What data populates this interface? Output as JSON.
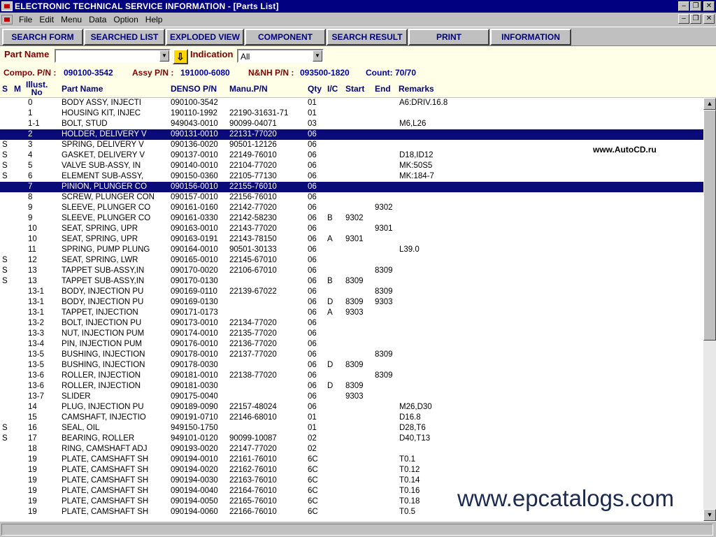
{
  "window": {
    "title": "ELECTRONIC TECHNICAL SERVICE INFORMATION - [Parts List]"
  },
  "menu": [
    "File",
    "Edit",
    "Menu",
    "Data",
    "Option",
    "Help"
  ],
  "toolbar": [
    "SEARCH FORM",
    "SEARCHED LIST",
    "EXPLODED VIEW",
    "COMPONENT",
    "SEARCH RESULT",
    "PRINT",
    "INFORMATION"
  ],
  "filter": {
    "part_name_label": "Part Name",
    "part_name_value": "",
    "indication_label": "Indication",
    "indication_value": "All"
  },
  "info": {
    "compo_label": "Compo. P/N :",
    "compo_value": "090100-3542",
    "assy_label": "Assy P/N :",
    "assy_value": "191000-6080",
    "nnh_label": "N&NH P/N :",
    "nnh_value": "093500-1820",
    "count_label": "Count:",
    "count_value": "70/70"
  },
  "columns": {
    "s": "S",
    "m": "M",
    "illust_1": "Illust.",
    "illust_2": "No",
    "name": "Part Name",
    "denso": "DENSO P/N",
    "manu": "Manu.P/N",
    "qty": "Qty",
    "ic": "I/C",
    "start": "Start",
    "end": "End",
    "remarks": "Remarks"
  },
  "rows": [
    {
      "s": "",
      "no": "0",
      "name": "BODY ASSY, INJECTI",
      "denso": "090100-3542",
      "manu": "",
      "qty": "01",
      "ic": "",
      "start": "",
      "end": "",
      "rem": "A6:DRIV.16.8"
    },
    {
      "s": "",
      "no": "1",
      "name": "HOUSING KIT, INJEC",
      "denso": "190110-1992",
      "manu": "22190-31631-71",
      "qty": "01",
      "ic": "",
      "start": "",
      "end": "",
      "rem": ""
    },
    {
      "s": "",
      "no": "1-1",
      "name": "BOLT, STUD",
      "denso": "949043-0010",
      "manu": "90099-04071",
      "qty": "03",
      "ic": "",
      "start": "",
      "end": "",
      "rem": "M6,L26"
    },
    {
      "s": "",
      "no": "2",
      "name": "HOLDER, DELIVERY V",
      "denso": "090131-0010",
      "manu": "22131-77020",
      "qty": "06",
      "ic": "",
      "start": "",
      "end": "",
      "rem": "",
      "sel": true
    },
    {
      "s": "S",
      "no": "3",
      "name": "SPRING, DELIVERY V",
      "denso": "090136-0020",
      "manu": "90501-12126",
      "qty": "06",
      "ic": "",
      "start": "",
      "end": "",
      "rem": ""
    },
    {
      "s": "S",
      "no": "4",
      "name": "GASKET, DELIVERY V",
      "denso": "090137-0010",
      "manu": "22149-76010",
      "qty": "06",
      "ic": "",
      "start": "",
      "end": "",
      "rem": "D18,ID12"
    },
    {
      "s": "S",
      "no": "5",
      "name": "VALVE SUB-ASSY, IN",
      "denso": "090140-0010",
      "manu": "22104-77020",
      "qty": "06",
      "ic": "",
      "start": "",
      "end": "",
      "rem": "MK:50S5"
    },
    {
      "s": "S",
      "no": "6",
      "name": "ELEMENT SUB-ASSY,",
      "denso": "090150-0360",
      "manu": "22105-77130",
      "qty": "06",
      "ic": "",
      "start": "",
      "end": "",
      "rem": "MK:184-7"
    },
    {
      "s": "",
      "no": "7",
      "name": "PINION, PLUNGER CO",
      "denso": "090156-0010",
      "manu": "22155-76010",
      "qty": "06",
      "ic": "",
      "start": "",
      "end": "",
      "rem": "",
      "sel": true
    },
    {
      "s": "",
      "no": "8",
      "name": "SCREW, PLUNGER CON",
      "denso": "090157-0010",
      "manu": "22156-76010",
      "qty": "06",
      "ic": "",
      "start": "",
      "end": "",
      "rem": ""
    },
    {
      "s": "",
      "no": "9",
      "name": "SLEEVE, PLUNGER CO",
      "denso": "090161-0160",
      "manu": "22142-77020",
      "qty": "06",
      "ic": "",
      "start": "",
      "end": "9302",
      "rem": ""
    },
    {
      "s": "",
      "no": "9",
      "name": "SLEEVE, PLUNGER CO",
      "denso": "090161-0330",
      "manu": "22142-58230",
      "qty": "06",
      "ic": "B",
      "start": "9302",
      "end": "",
      "rem": ""
    },
    {
      "s": "",
      "no": "10",
      "name": "SEAT, SPRING, UPR",
      "denso": "090163-0010",
      "manu": "22143-77020",
      "qty": "06",
      "ic": "",
      "start": "",
      "end": "9301",
      "rem": ""
    },
    {
      "s": "",
      "no": "10",
      "name": "SEAT, SPRING, UPR",
      "denso": "090163-0191",
      "manu": "22143-78150",
      "qty": "06",
      "ic": "A",
      "start": "9301",
      "end": "",
      "rem": ""
    },
    {
      "s": "",
      "no": "11",
      "name": "SPRING, PUMP PLUNG",
      "denso": "090164-0010",
      "manu": "90501-30133",
      "qty": "06",
      "ic": "",
      "start": "",
      "end": "",
      "rem": "L39.0"
    },
    {
      "s": "S",
      "no": "12",
      "name": "SEAT, SPRING, LWR",
      "denso": "090165-0010",
      "manu": "22145-67010",
      "qty": "06",
      "ic": "",
      "start": "",
      "end": "",
      "rem": ""
    },
    {
      "s": "S",
      "no": "13",
      "name": "TAPPET SUB-ASSY,IN",
      "denso": "090170-0020",
      "manu": "22106-67010",
      "qty": "06",
      "ic": "",
      "start": "",
      "end": "8309",
      "rem": ""
    },
    {
      "s": "S",
      "no": "13",
      "name": "TAPPET SUB-ASSY,IN",
      "denso": "090170-0130",
      "manu": "",
      "qty": "06",
      "ic": "B",
      "start": "8309",
      "end": "",
      "rem": ""
    },
    {
      "s": "",
      "no": "13-1",
      "name": "BODY, INJECTION PU",
      "denso": "090169-0110",
      "manu": "22139-67022",
      "qty": "06",
      "ic": "",
      "start": "",
      "end": "8309",
      "rem": ""
    },
    {
      "s": "",
      "no": "13-1",
      "name": "BODY, INJECTION PU",
      "denso": "090169-0130",
      "manu": "",
      "qty": "06",
      "ic": "D",
      "start": "8309",
      "end": "9303",
      "rem": ""
    },
    {
      "s": "",
      "no": "13-1",
      "name": "TAPPET, INJECTION",
      "denso": "090171-0173",
      "manu": "",
      "qty": "06",
      "ic": "A",
      "start": "9303",
      "end": "",
      "rem": ""
    },
    {
      "s": "",
      "no": "13-2",
      "name": "BOLT, INJECTION PU",
      "denso": "090173-0010",
      "manu": "22134-77020",
      "qty": "06",
      "ic": "",
      "start": "",
      "end": "",
      "rem": ""
    },
    {
      "s": "",
      "no": "13-3",
      "name": "NUT, INJECTION PUM",
      "denso": "090174-0010",
      "manu": "22135-77020",
      "qty": "06",
      "ic": "",
      "start": "",
      "end": "",
      "rem": ""
    },
    {
      "s": "",
      "no": "13-4",
      "name": "PIN, INJECTION PUM",
      "denso": "090176-0010",
      "manu": "22136-77020",
      "qty": "06",
      "ic": "",
      "start": "",
      "end": "",
      "rem": ""
    },
    {
      "s": "",
      "no": "13-5",
      "name": "BUSHING, INJECTION",
      "denso": "090178-0010",
      "manu": "22137-77020",
      "qty": "06",
      "ic": "",
      "start": "",
      "end": "8309",
      "rem": ""
    },
    {
      "s": "",
      "no": "13-5",
      "name": "BUSHING, INJECTION",
      "denso": "090178-0030",
      "manu": "",
      "qty": "06",
      "ic": "D",
      "start": "8309",
      "end": "",
      "rem": ""
    },
    {
      "s": "",
      "no": "13-6",
      "name": "ROLLER, INJECTION",
      "denso": "090181-0010",
      "manu": "22138-77020",
      "qty": "06",
      "ic": "",
      "start": "",
      "end": "8309",
      "rem": ""
    },
    {
      "s": "",
      "no": "13-6",
      "name": "ROLLER, INJECTION",
      "denso": "090181-0030",
      "manu": "",
      "qty": "06",
      "ic": "D",
      "start": "8309",
      "end": "",
      "rem": ""
    },
    {
      "s": "",
      "no": "13-7",
      "name": "SLIDER",
      "denso": "090175-0040",
      "manu": "",
      "qty": "06",
      "ic": "",
      "start": "9303",
      "end": "",
      "rem": ""
    },
    {
      "s": "",
      "no": "14",
      "name": "PLUG, INJECTION PU",
      "denso": "090189-0090",
      "manu": "22157-48024",
      "qty": "06",
      "ic": "",
      "start": "",
      "end": "",
      "rem": "M26,D30"
    },
    {
      "s": "",
      "no": "15",
      "name": "CAMSHAFT, INJECTIO",
      "denso": "090191-0710",
      "manu": "22146-68010",
      "qty": "01",
      "ic": "",
      "start": "",
      "end": "",
      "rem": "D16.8"
    },
    {
      "s": "S",
      "no": "16",
      "name": "SEAL, OIL",
      "denso": "949150-1750",
      "manu": "",
      "qty": "01",
      "ic": "",
      "start": "",
      "end": "",
      "rem": "D28,T6"
    },
    {
      "s": "S",
      "no": "17",
      "name": "BEARING, ROLLER",
      "denso": "949101-0120",
      "manu": "90099-10087",
      "qty": "02",
      "ic": "",
      "start": "",
      "end": "",
      "rem": "D40,T13"
    },
    {
      "s": "",
      "no": "18",
      "name": "RING, CAMSHAFT ADJ",
      "denso": "090193-0020",
      "manu": "22147-77020",
      "qty": "02",
      "ic": "",
      "start": "",
      "end": "",
      "rem": ""
    },
    {
      "s": "",
      "no": "19",
      "name": "PLATE, CAMSHAFT SH",
      "denso": "090194-0010",
      "manu": "22161-76010",
      "qty": "6C",
      "ic": "",
      "start": "",
      "end": "",
      "rem": "T0.1"
    },
    {
      "s": "",
      "no": "19",
      "name": "PLATE, CAMSHAFT SH",
      "denso": "090194-0020",
      "manu": "22162-76010",
      "qty": "6C",
      "ic": "",
      "start": "",
      "end": "",
      "rem": "T0.12"
    },
    {
      "s": "",
      "no": "19",
      "name": "PLATE, CAMSHAFT SH",
      "denso": "090194-0030",
      "manu": "22163-76010",
      "qty": "6C",
      "ic": "",
      "start": "",
      "end": "",
      "rem": "T0.14"
    },
    {
      "s": "",
      "no": "19",
      "name": "PLATE, CAMSHAFT SH",
      "denso": "090194-0040",
      "manu": "22164-76010",
      "qty": "6C",
      "ic": "",
      "start": "",
      "end": "",
      "rem": "T0.16"
    },
    {
      "s": "",
      "no": "19",
      "name": "PLATE, CAMSHAFT SH",
      "denso": "090194-0050",
      "manu": "22165-76010",
      "qty": "6C",
      "ic": "",
      "start": "",
      "end": "",
      "rem": "T0.18"
    },
    {
      "s": "",
      "no": "19",
      "name": "PLATE, CAMSHAFT SH",
      "denso": "090194-0060",
      "manu": "22166-76010",
      "qty": "6C",
      "ic": "",
      "start": "",
      "end": "",
      "rem": "T0.5"
    }
  ],
  "watermarks": {
    "small": "www.AutoCD.ru",
    "big": "www.epcatalogs.com"
  }
}
